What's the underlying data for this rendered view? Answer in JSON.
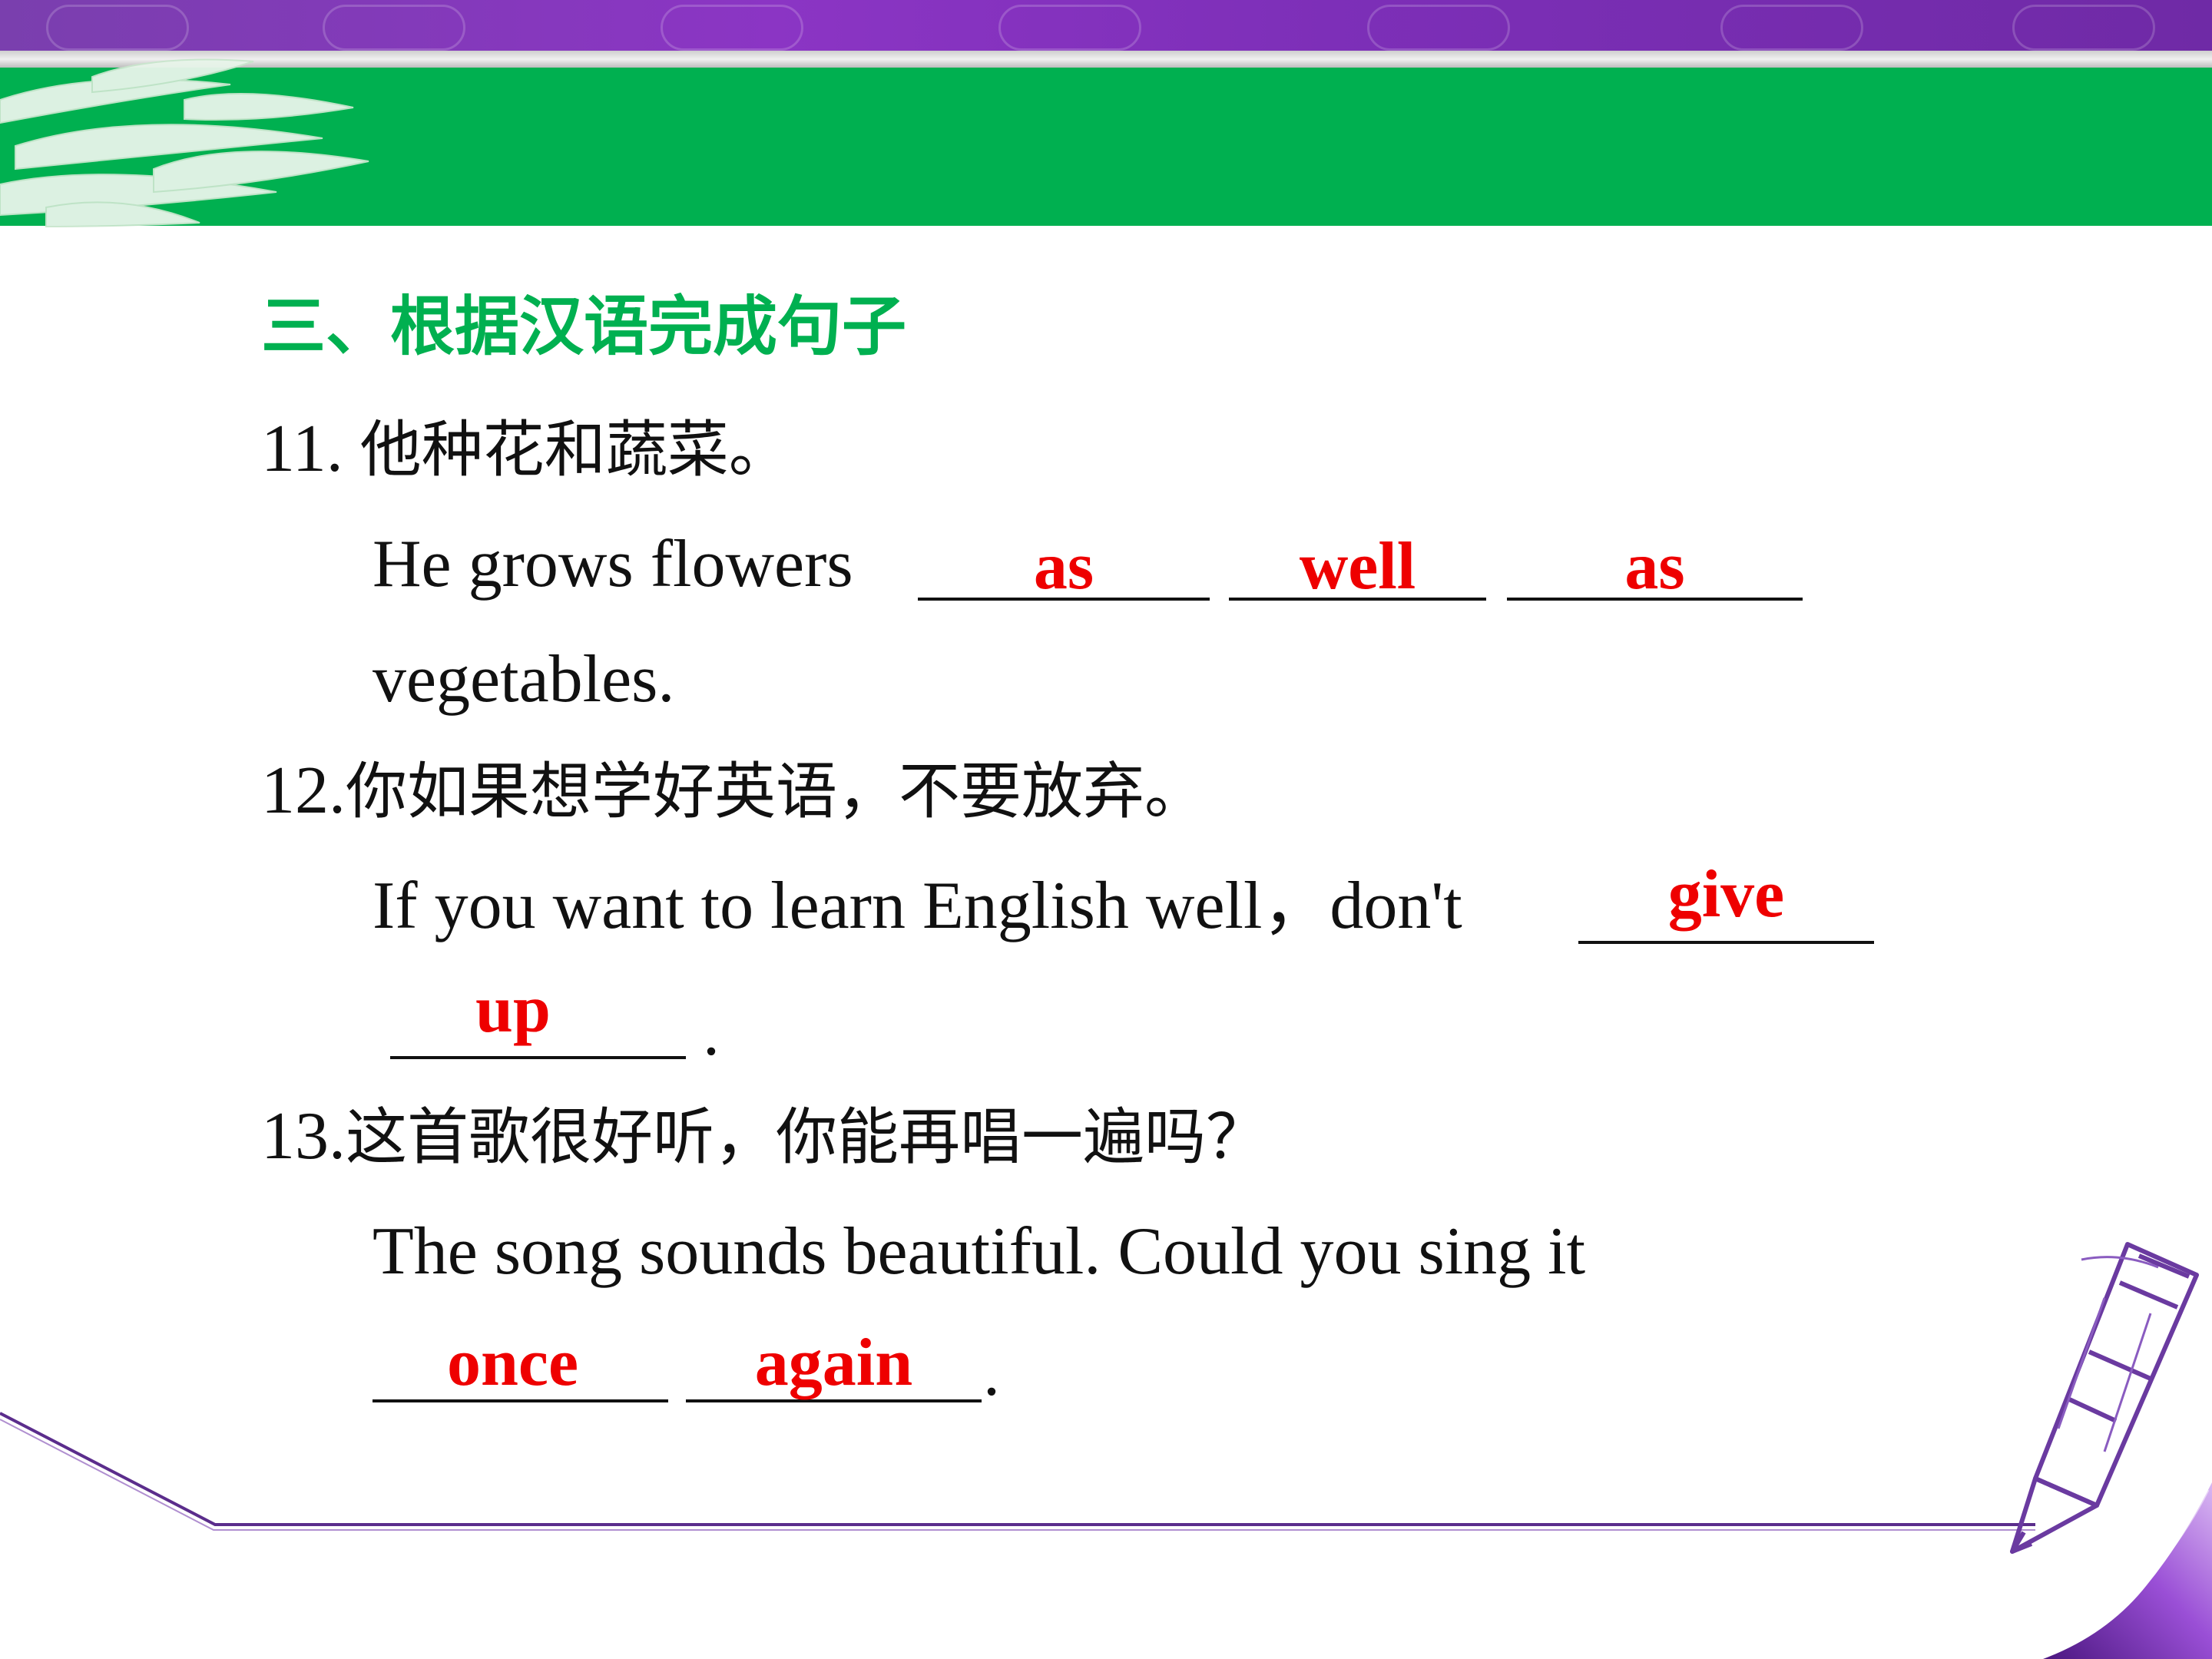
{
  "section": {
    "title": "三、根据汉语完成句子"
  },
  "questions": [
    {
      "number": "11.",
      "chinese": "他种花和蔬菜。",
      "english_line1": "He grows flowers",
      "english_line2": "vegetables.",
      "answers": [
        "as",
        "well",
        "as"
      ]
    },
    {
      "number": "12.",
      "chinese": "你如果想学好英语，不要放弃。",
      "english_line1": "If you want to learn English well，don't",
      "english_end": ".",
      "answers": [
        "give",
        "up"
      ]
    },
    {
      "number": "13.",
      "chinese": "这首歌很好听，你能再唱一遍吗？",
      "english_line1": "The song sounds beautiful. Could you sing it",
      "english_end": ".",
      "answers": [
        "once",
        "again"
      ]
    }
  ],
  "colors": {
    "header_purple": "#7d2fb8",
    "header_green": "#00b050",
    "answer_red": "#ee0000",
    "title_green": "#00b050"
  },
  "decorations": [
    "bamboo-leaves",
    "pencil",
    "page-curl"
  ]
}
